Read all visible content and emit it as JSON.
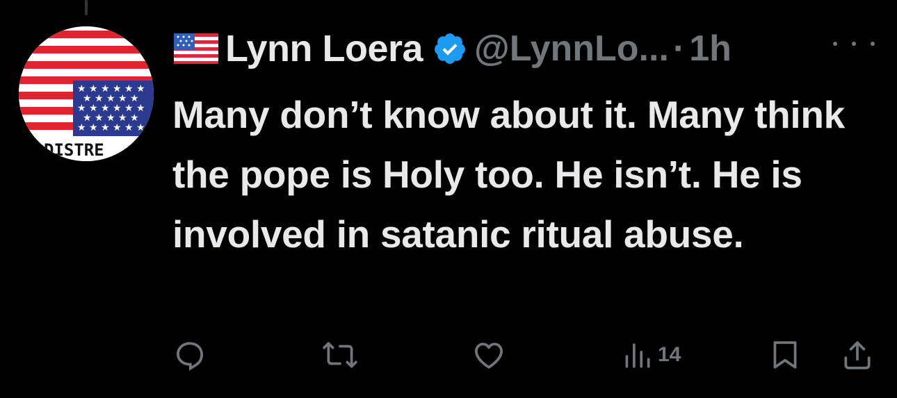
{
  "tweet": {
    "display_name": "Lynn Loera",
    "handle": "@LynnLo...",
    "separator": "·",
    "time": "1h",
    "text": "Many don’t know about it. Many think the pope is Holy too. He isn’t. He is involved in satanic ritual abuse.",
    "avatar_text": "DISTRE",
    "verified": true
  },
  "actions": {
    "views_count": "14"
  },
  "colors": {
    "background": "#000000",
    "text": "#e7e9ea",
    "muted": "#71767b",
    "verified_blue": "#1d9bf0"
  }
}
